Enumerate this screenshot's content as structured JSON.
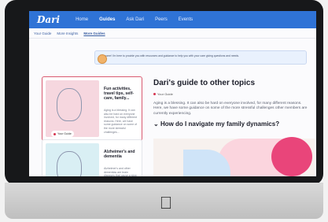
{
  "nav": {
    "brand": "Dari",
    "links": [
      "Home",
      "Guides",
      "Ask Dari",
      "Peers",
      "Events"
    ]
  },
  "subnav": {
    "items": [
      "Your Guide",
      "More Insights",
      "More Guides"
    ]
  },
  "banner": {
    "text": "Welcome! I'm here to provide you with resources and guidance to help you with your care giving questions and needs."
  },
  "cards": [
    {
      "title": "Fun activities, travel tips, self-care, family...",
      "text": "Aging is a blessing. It can also be hard on everyone involved, for many different reasons. Here, we have some guidance on some of the more stressful challenges...",
      "badge": "Your Guide"
    },
    {
      "title": "Alzheimer's and dementia",
      "text": "Alzheimer's and other dementias are brain diseases that cause a slow decline in memory, thinking, and reasoning skills..."
    }
  ],
  "main": {
    "title": "Dari's guide to other topics",
    "tag": "Your Guide",
    "body": "Aging is a blessing. It can also be hard on everyone involved, for many different reasons. Here, we have some guidance on some of the more stressful challenges other members are currently experiencing.",
    "section_title": "How do I navigate my family dynamics?"
  },
  "colors": {
    "nav": "#2f73d6",
    "accent_pink": "#e9457a"
  },
  "icons": {
    "chevron": "chevron-down-icon",
    "apple": "apple-logo"
  }
}
